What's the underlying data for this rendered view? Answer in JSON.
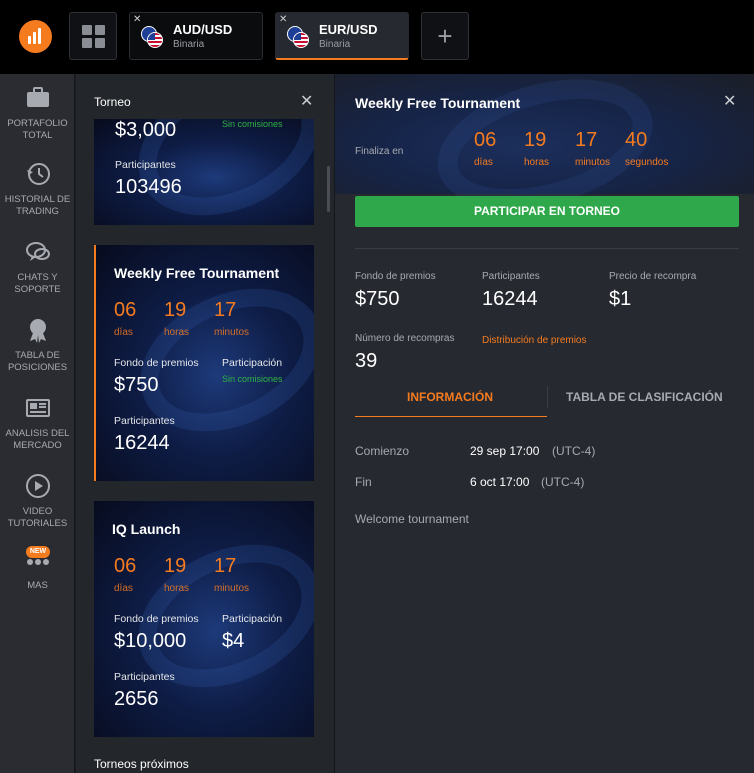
{
  "tabs": [
    {
      "pair": "AUD/USD",
      "type": "Binaria",
      "close": "✕"
    },
    {
      "pair": "EUR/USD",
      "type": "Binaria",
      "close": "✕"
    }
  ],
  "add_tab": "+",
  "sidebar": {
    "items": [
      {
        "line1": "PORTAFOLIO",
        "line2": "TOTAL",
        "icon": "briefcase-icon"
      },
      {
        "line1": "HISTORIAL DE",
        "line2": "TRADING",
        "icon": "history-icon"
      },
      {
        "line1": "CHATS Y",
        "line2": "SOPORTE",
        "icon": "chat-icon"
      },
      {
        "line1": "TABLA DE",
        "line2": "POSICIONES",
        "icon": "medal-icon"
      },
      {
        "line1": "ANALISIS DEL",
        "line2": "MERCADO",
        "icon": "newspaper-icon"
      },
      {
        "line1": "VIDEO",
        "line2": "TUTORIALES",
        "icon": "play-icon"
      },
      {
        "line1": "MAS",
        "line2": "",
        "icon": "more-icon",
        "badge": "NEW"
      }
    ]
  },
  "list": {
    "title": "Torneo",
    "close": "✕",
    "footer": "Torneos próximos",
    "cards": [
      {
        "prize": "$3,000",
        "no_fee": "Sin comisiones",
        "participants_label": "Participantes",
        "participants": "103496"
      },
      {
        "name": "Weekly Free Tournament",
        "days": "06",
        "hours": "19",
        "minutes": "17",
        "days_label": "días",
        "hours_label": "horas",
        "minutes_label": "minutos",
        "prize_label": "Fondo de premios",
        "prize": "$750",
        "entry_label": "Participación",
        "entry": "Sin comisiones",
        "participants_label": "Participantes",
        "participants": "16244"
      },
      {
        "name": "IQ Launch",
        "days": "06",
        "hours": "19",
        "minutes": "17",
        "days_label": "días",
        "hours_label": "horas",
        "minutes_label": "minutos",
        "prize_label": "Fondo de premios",
        "prize": "$10,000",
        "entry_label": "Participación",
        "entry": "$4",
        "participants_label": "Participantes",
        "participants": "2656"
      }
    ]
  },
  "detail": {
    "title": "Weekly Free Tournament",
    "close": "✕",
    "ends_label": "Finaliza en",
    "countdown": [
      {
        "value": "06",
        "unit": "días"
      },
      {
        "value": "19",
        "unit": "horas"
      },
      {
        "value": "17",
        "unit": "minutos"
      },
      {
        "value": "40",
        "unit": "segundos"
      }
    ],
    "join_button": "PARTICIPAR EN TORNEO",
    "stats": {
      "prize_label": "Fondo de premios",
      "prize": "$750",
      "participants_label": "Participantes",
      "participants": "16244",
      "rebuy_price_label": "Precio de recompra",
      "rebuy_price": "$1",
      "rebuys_label": "Número de recompras",
      "rebuys": "39",
      "prize_distribution": "Distribución de premios"
    },
    "tabs": [
      "INFORMACIÓN",
      "TABLA DE CLASIFICACIÓN"
    ],
    "info": {
      "start_label": "Comienzo",
      "start": "29 sep 17:00",
      "start_tz": "(UTC-4)",
      "end_label": "Fin",
      "end": "6 oct 17:00",
      "end_tz": "(UTC-4)",
      "description": "Welcome tournament"
    }
  },
  "colors": {
    "accent": "#f57b1f",
    "green": "#2ea84a",
    "sidebar": "#2a2c32"
  }
}
